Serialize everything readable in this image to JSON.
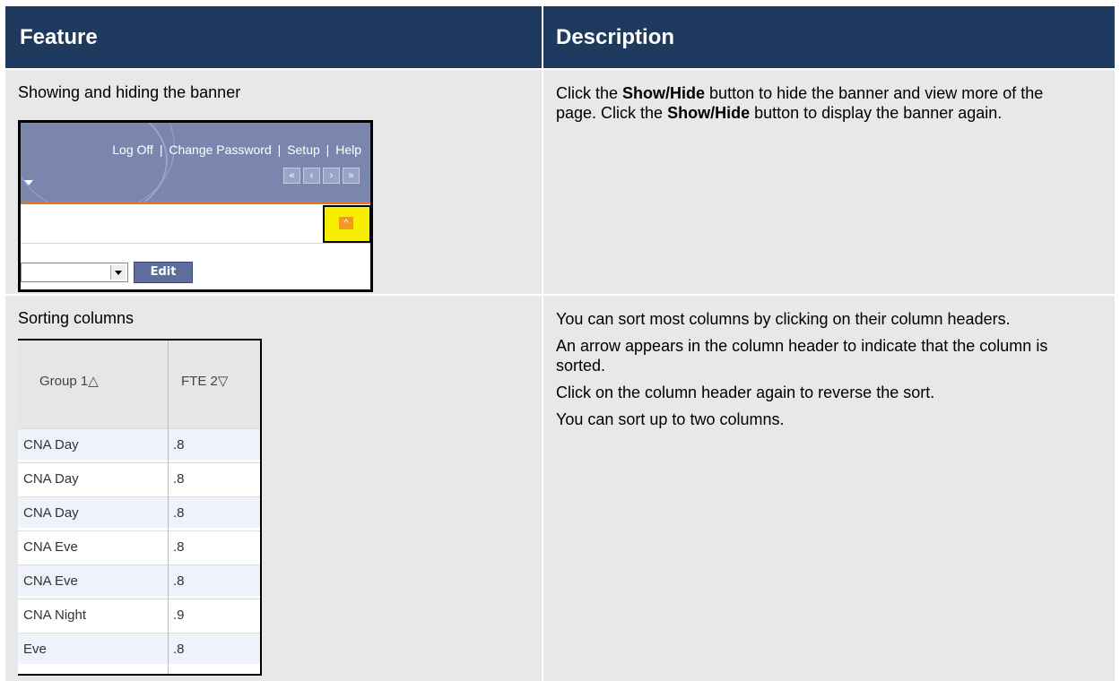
{
  "table": {
    "headers": {
      "feature": "Feature",
      "description": "Description"
    },
    "row1": {
      "feature": "Showing and hiding the banner",
      "desc": {
        "p1_pre": "Click the ",
        "p1_b1": "Show/Hide",
        "p1_mid": " button to hide the banner and view more of the page. Click the ",
        "p1_b2": "Show/Hide",
        "p1_post": " button to display the banner again."
      },
      "screenshot": {
        "links": [
          "Log Off",
          "Change Password",
          "Setup",
          "Help"
        ],
        "separator": "|",
        "nav_buttons": [
          "«",
          "‹",
          "›",
          "»"
        ],
        "show_hide_glyph": "^",
        "edit_label": "Edit"
      }
    },
    "row2": {
      "feature": "Sorting columns",
      "desc": [
        "You can sort most columns by clicking on their column headers.",
        "An arrow appears in the column header to indicate that the column is sorted.",
        "Click on the column header again to reverse the sort.",
        "You can sort up to two columns."
      ],
      "screenshot": {
        "col1_header": "Group  1△",
        "col2_header": "FTE  2▽",
        "rows": [
          {
            "group": "CNA Day",
            "fte": ".8"
          },
          {
            "group": "CNA Day",
            "fte": ".8"
          },
          {
            "group": "CNA Day",
            "fte": ".8"
          },
          {
            "group": "CNA Eve",
            "fte": ".8"
          },
          {
            "group": "CNA Eve",
            "fte": ".8"
          },
          {
            "group": "CNA Night",
            "fte": ".9"
          },
          {
            "group": "Eve",
            "fte": ".8"
          }
        ]
      }
    }
  },
  "colors": {
    "header_bg": "#1e3a5f",
    "row_bg": "#e8e8e8",
    "banner_bg": "#7a86ad",
    "highlight": "#f6f000",
    "accent_orange": "#e8751a"
  }
}
